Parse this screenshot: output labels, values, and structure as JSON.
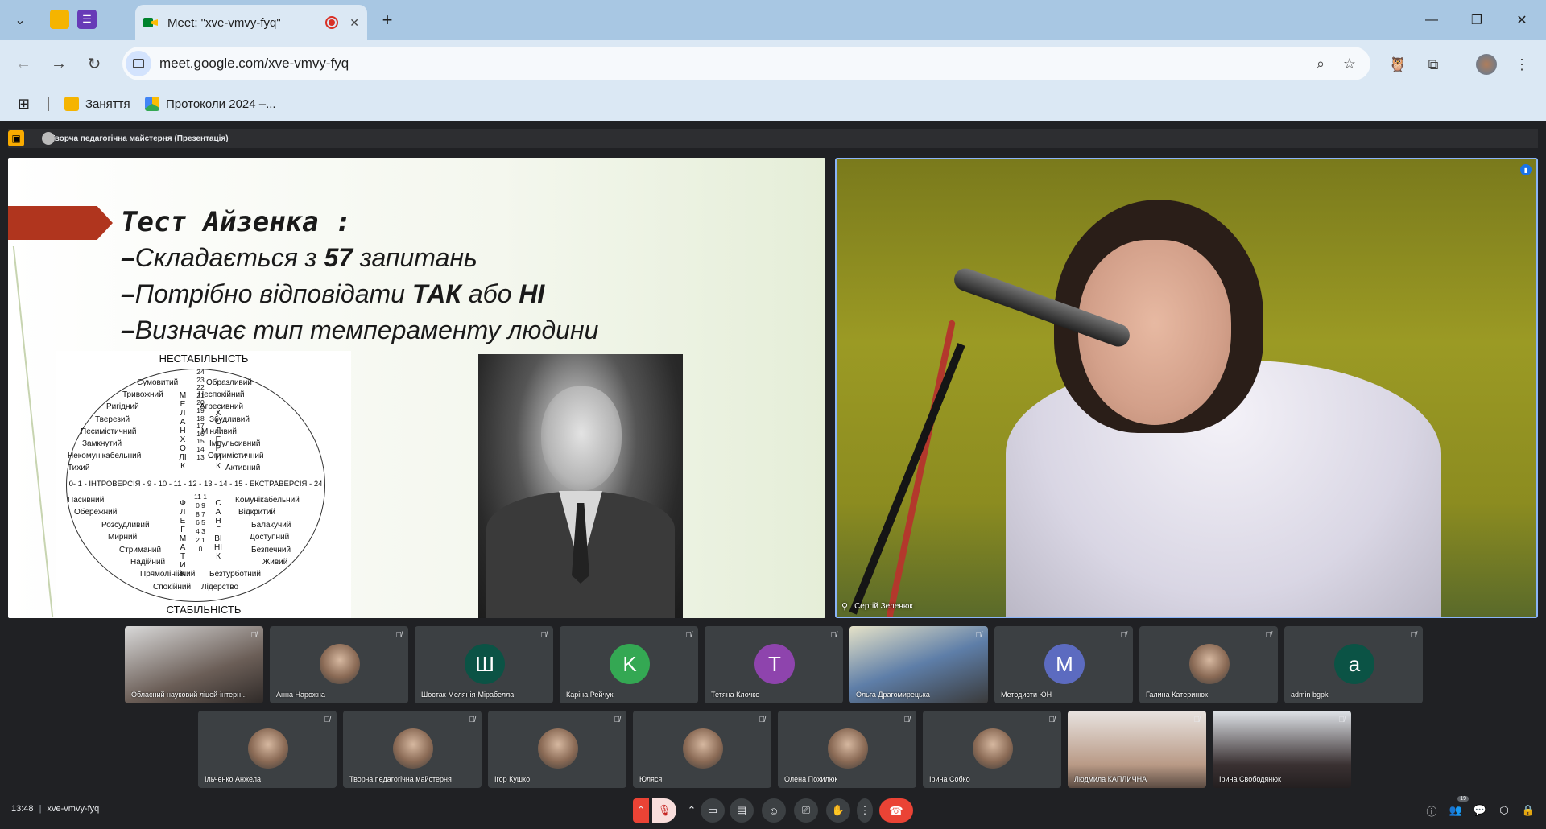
{
  "browser": {
    "tab_title": "Meet: \"xve-vmvy-fyq\"",
    "url": "meet.google.com/xve-vmvy-fyq",
    "new_tab_label": "+",
    "bookmarks": [
      {
        "label": "Заняття"
      },
      {
        "label": "Протоколи 2024 –..."
      }
    ]
  },
  "presentation": {
    "bar_title": "Творча педагогічна майстерня (Презентація)",
    "slide": {
      "title": "Тест Айзенка :",
      "lines": [
        {
          "dash": "–",
          "pre": "Складається з ",
          "bold": "57",
          "post": " запитань"
        },
        {
          "dash": "–",
          "pre": "Потрібно відповідати ",
          "bold": "ТАК",
          "post": " або ",
          "bold2": "НІ"
        },
        {
          "dash": "–",
          "pre": "Визначає тип темпераменту людини"
        }
      ],
      "diagram": {
        "top": "НЕСТАБІЛЬНІСТЬ",
        "bottom": "СТАБІЛЬНІСТЬ",
        "axis": "0- 1 - ІНТРОВЕРСІЯ - 9 - 10 - 11 - 12 - 13 - 14 - 15 - ЕКСТРАВЕРСІЯ - 24",
        "left_top_traits": [
          "Сумовитий",
          "Тривожний",
          "Ригідний",
          "Тверезий",
          "Песимістичний",
          "Замкнутий",
          "Некомунікабельний",
          "Тихий"
        ],
        "right_top_traits": [
          "Образливий",
          "Неспокійний",
          "Агресивний",
          "Збудливий",
          "Мінливий",
          "Імпульсивний",
          "Оптимістичний",
          "Активний"
        ],
        "left_bottom_traits": [
          "Пасивний",
          "Обережний",
          "Розсудливий",
          "Мирний",
          "Стриманий",
          "Надійний",
          "Прямолінійний",
          "Спокійний"
        ],
        "right_bottom_traits": [
          "Комунікабельний",
          "Відкритий",
          "Балакучий",
          "Доступний",
          "Безпечний",
          "Живий",
          "Безтурботний",
          "Лідерство"
        ],
        "v_top_numbers": "24 23 22 21 20 19 18 17 16 15 14 13",
        "v_bottom_numbers": "11 10 9 8 7 6 5 4 3 2 1 0",
        "melancholic": "МЕЛАНХОЛІК",
        "choleric": "ХОЛЕРИК",
        "phlegmatic": "ФЛЕГМАТИК",
        "sanguine": "САНГВІНІК"
      }
    }
  },
  "speaker": {
    "name": "Сергій Зеленюк"
  },
  "participants": [
    {
      "name": "Обласний науковий ліцей-інтерн...",
      "type": "video"
    },
    {
      "name": "Анна Нарожна",
      "type": "photo"
    },
    {
      "name": "Шостак Мелянія-Мірабелла",
      "type": "letter",
      "letter": "Ш",
      "color": "#0b5345"
    },
    {
      "name": "Каріна Рейчук",
      "type": "letter",
      "letter": "K",
      "color": "#34a853"
    },
    {
      "name": "Тетяна Клочко",
      "type": "letter",
      "letter": "T",
      "color": "#8e44ad"
    },
    {
      "name": "Ольга Драгомирецька",
      "type": "video"
    },
    {
      "name": "Методисти ЮН",
      "type": "letter",
      "letter": "M",
      "color": "#5c6bc0"
    },
    {
      "name": "Галина Катеринюк",
      "type": "photo"
    },
    {
      "name": "admin bgpk",
      "type": "letter",
      "letter": "a",
      "color": "#0b5345"
    },
    {
      "name": "Ільченко Анжела",
      "type": "photo"
    },
    {
      "name": "Творча педагогічна майстерня",
      "type": "photo"
    },
    {
      "name": "Ігор Кушко",
      "type": "photo"
    },
    {
      "name": "Юляся",
      "type": "photo"
    },
    {
      "name": "Олена Похилюк",
      "type": "photo"
    },
    {
      "name": "Ірина Собко",
      "type": "photo"
    },
    {
      "name": "Людмила КАПЛИЧНА",
      "type": "video"
    },
    {
      "name": "Ірина Свободянюк",
      "type": "video"
    }
  ],
  "bottom_bar": {
    "time": "13:48",
    "meeting_code": "xve-vmvy-fyq",
    "people_count": "19"
  }
}
